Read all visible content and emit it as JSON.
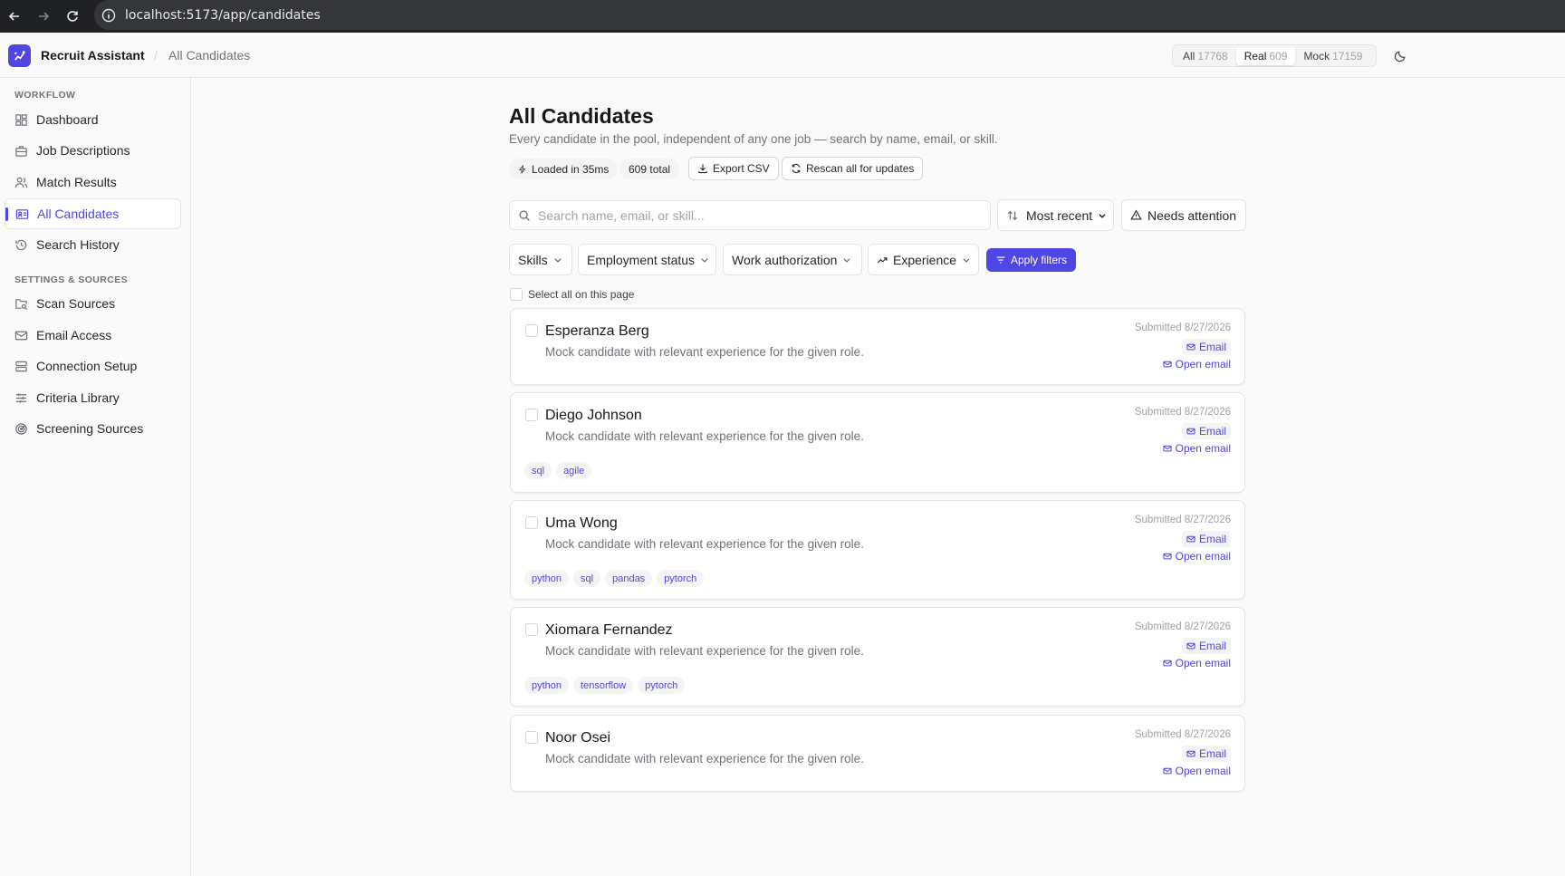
{
  "browser": {
    "url": "localhost:5173/app/candidates"
  },
  "header": {
    "app_name": "Recruit Assistant",
    "separator": "/",
    "breadcrumb": "All Candidates",
    "segments": [
      {
        "label": "All",
        "count": "17768"
      },
      {
        "label": "Real",
        "count": "609"
      },
      {
        "label": "Mock",
        "count": "17159"
      }
    ],
    "active_segment": "Real"
  },
  "sidebar": {
    "workflow_label": "WORKFLOW",
    "workflow_items": [
      {
        "label": "Dashboard",
        "icon": "dashboard-icon"
      },
      {
        "label": "Job Descriptions",
        "icon": "briefcase-icon"
      },
      {
        "label": "Match Results",
        "icon": "users-icon"
      },
      {
        "label": "All Candidates",
        "icon": "id-card-icon"
      },
      {
        "label": "Search History",
        "icon": "history-icon"
      }
    ],
    "settings_label": "SETTINGS & SOURCES",
    "settings_items": [
      {
        "label": "Scan Sources",
        "icon": "folder-search-icon"
      },
      {
        "label": "Email Access",
        "icon": "mail-icon"
      },
      {
        "label": "Connection Setup",
        "icon": "server-icon"
      },
      {
        "label": "Criteria Library",
        "icon": "sliders-icon"
      },
      {
        "label": "Screening Sources",
        "icon": "radar-icon"
      }
    ],
    "active_item": "All Candidates"
  },
  "main": {
    "title": "All Candidates",
    "subtitle": "Every candidate in the pool, independent of any one job — search by name, email, or skill.",
    "loaded_text": "Loaded in 35ms",
    "total_text": "609 total",
    "export_label": "Export CSV",
    "rescan_label": "Rescan all for updates",
    "search_placeholder": "Search name, email, or skill...",
    "sort_value": "Most recent",
    "needs_attention_label": "Needs attention",
    "filters": {
      "skills": "Skills",
      "employment": "Employment status",
      "work_auth": "Work authorization",
      "experience": "Experience",
      "apply": "Apply filters"
    },
    "select_all_label": "Select all on this page",
    "email_label": "Email",
    "open_email_label": "Open email",
    "candidates": [
      {
        "name": "Esperanza Berg",
        "description": "Mock candidate with relevant experience for the given role.",
        "submitted": "Submitted 8/27/2026",
        "tags": []
      },
      {
        "name": "Diego Johnson",
        "description": "Mock candidate with relevant experience for the given role.",
        "submitted": "Submitted 8/27/2026",
        "tags": [
          "sql",
          "agile"
        ]
      },
      {
        "name": "Uma Wong",
        "description": "Mock candidate with relevant experience for the given role.",
        "submitted": "Submitted 8/27/2026",
        "tags": [
          "python",
          "sql",
          "pandas",
          "pytorch"
        ]
      },
      {
        "name": "Xiomara Fernandez",
        "description": "Mock candidate with relevant experience for the given role.",
        "submitted": "Submitted 8/27/2026",
        "tags": [
          "python",
          "tensorflow",
          "pytorch"
        ]
      },
      {
        "name": "Noor Osei",
        "description": "Mock candidate with relevant experience for the given role.",
        "submitted": "Submitted 8/27/2026",
        "tags": []
      }
    ]
  },
  "colors": {
    "accent": "#4f46e5",
    "border": "#e4e4e7",
    "muted": "#71717a"
  }
}
